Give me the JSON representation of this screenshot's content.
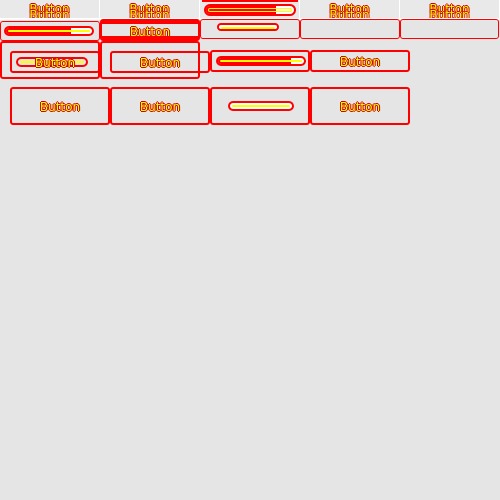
{
  "colors": {
    "background": "#e5e5e5",
    "outline": "#ff0000",
    "label_fill": "#ffff00"
  },
  "tab_strip": {
    "tabs": [
      {
        "label": "Button",
        "ghost_label": "Button"
      },
      {
        "label": "Button",
        "ghost_label": "Button"
      },
      {
        "progress": 0.8
      },
      {
        "label": "Button",
        "ghost_label": "Button"
      },
      {
        "label": "Button",
        "ghost_label": "Button"
      }
    ]
  },
  "row2": {
    "progress_a": 0.75,
    "button_label": "Button",
    "progress_b": 0.0
  },
  "row3": {
    "input_button_label": "Button",
    "button_b_label": "Button",
    "progress": 0.85,
    "button_d_label": "Button"
  },
  "row4": {
    "button_a_label": "Button",
    "button_b_label": "Button",
    "progress": 0.0,
    "button_d_label": "Button"
  }
}
